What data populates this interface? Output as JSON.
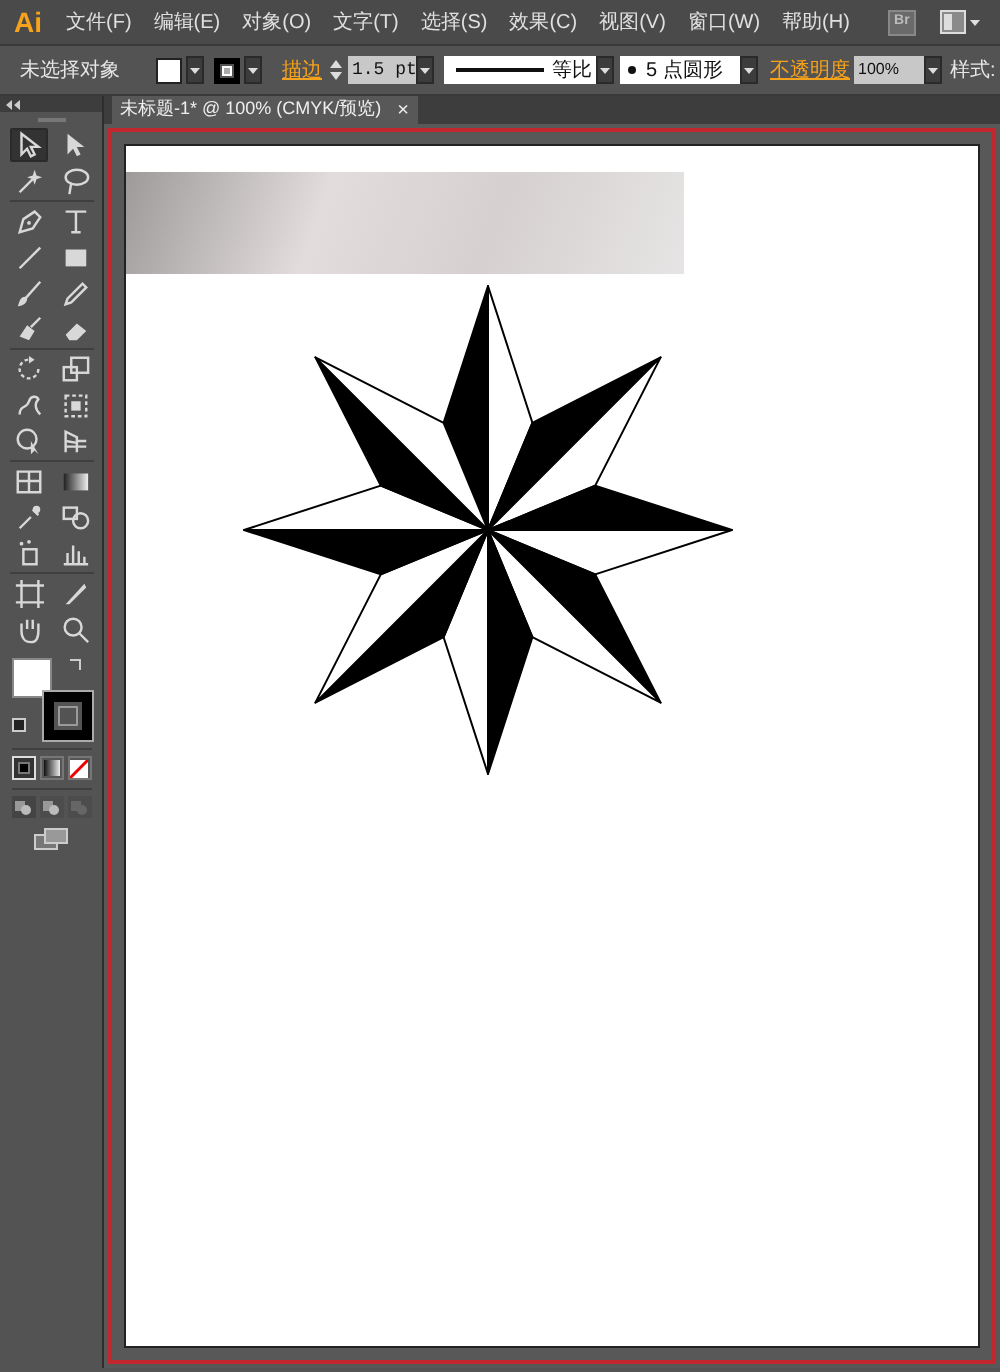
{
  "app_logo": "Ai",
  "menu": [
    {
      "label": "文件(F)"
    },
    {
      "label": "编辑(E)"
    },
    {
      "label": "对象(O)"
    },
    {
      "label": "文字(T)"
    },
    {
      "label": "选择(S)"
    },
    {
      "label": "效果(C)"
    },
    {
      "label": "视图(V)"
    },
    {
      "label": "窗口(W)"
    },
    {
      "label": "帮助(H)"
    }
  ],
  "bridge_button": "Br",
  "control_bar": {
    "selection": "未选择对象",
    "stroke_link": "描边",
    "stroke_weight": "1.5 pt",
    "stroke_profile": "等比",
    "brush": "5 点圆形",
    "opacity_link": "不透明度",
    "opacity": "100%",
    "style_label": "样式:"
  },
  "document_tab": {
    "title": "未标题-1* @ 100% (CMYK/预览)",
    "close": "×",
    "selected": true
  },
  "tool_groups": [
    [
      {
        "kind": "selection",
        "selected": true
      },
      {
        "kind": "direct-selection",
        "selected": false
      },
      {
        "kind": "magic-wand",
        "selected": false
      },
      {
        "kind": "lasso",
        "selected": false
      }
    ],
    [
      {
        "kind": "pen",
        "selected": false
      },
      {
        "kind": "type",
        "selected": false
      },
      {
        "kind": "line",
        "selected": false
      },
      {
        "kind": "rectangle",
        "selected": false
      },
      {
        "kind": "brush",
        "selected": false
      },
      {
        "kind": "pencil",
        "selected": false
      },
      {
        "kind": "blob",
        "selected": false
      },
      {
        "kind": "eraser",
        "selected": false
      }
    ],
    [
      {
        "kind": "rotate",
        "selected": false
      },
      {
        "kind": "scale",
        "selected": false
      },
      {
        "kind": "warp",
        "selected": false
      },
      {
        "kind": "free-transform",
        "selected": false
      },
      {
        "kind": "shape-builder",
        "selected": false
      },
      {
        "kind": "perspective",
        "selected": false
      }
    ],
    [
      {
        "kind": "mesh",
        "selected": false
      },
      {
        "kind": "gradient",
        "selected": false
      },
      {
        "kind": "eyedropper",
        "selected": false
      },
      {
        "kind": "blend",
        "selected": false
      },
      {
        "kind": "sprayer",
        "selected": false
      },
      {
        "kind": "graph",
        "selected": false
      }
    ],
    [
      {
        "kind": "artboard",
        "selected": false
      },
      {
        "kind": "slice",
        "selected": false
      },
      {
        "kind": "hand",
        "selected": false
      },
      {
        "kind": "zoom",
        "selected": false
      }
    ]
  ],
  "color_modes": [
    {
      "kind": "color",
      "selected": true
    },
    {
      "kind": "gradient",
      "selected": false
    },
    {
      "kind": "none",
      "selected": false
    }
  ]
}
